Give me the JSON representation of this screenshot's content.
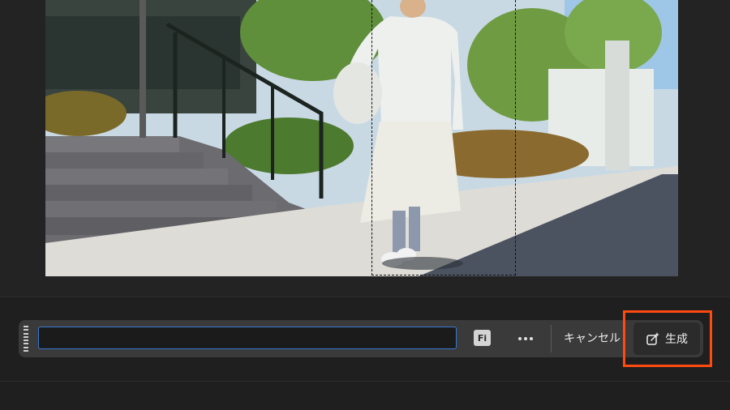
{
  "prompt": {
    "value": "",
    "placeholder": ""
  },
  "toolbar": {
    "fi_label": "Fi",
    "more_icon": "more-horizontal-icon",
    "cancel_label": "キャンセル",
    "generate_label": "生成",
    "generate_icon": "generate-sparkle-icon"
  },
  "colors": {
    "accent_focus": "#3b78d4",
    "highlight": "#ff4a10",
    "toolbar_bg": "#3a3a3a",
    "app_bg": "#1f1f1f"
  }
}
